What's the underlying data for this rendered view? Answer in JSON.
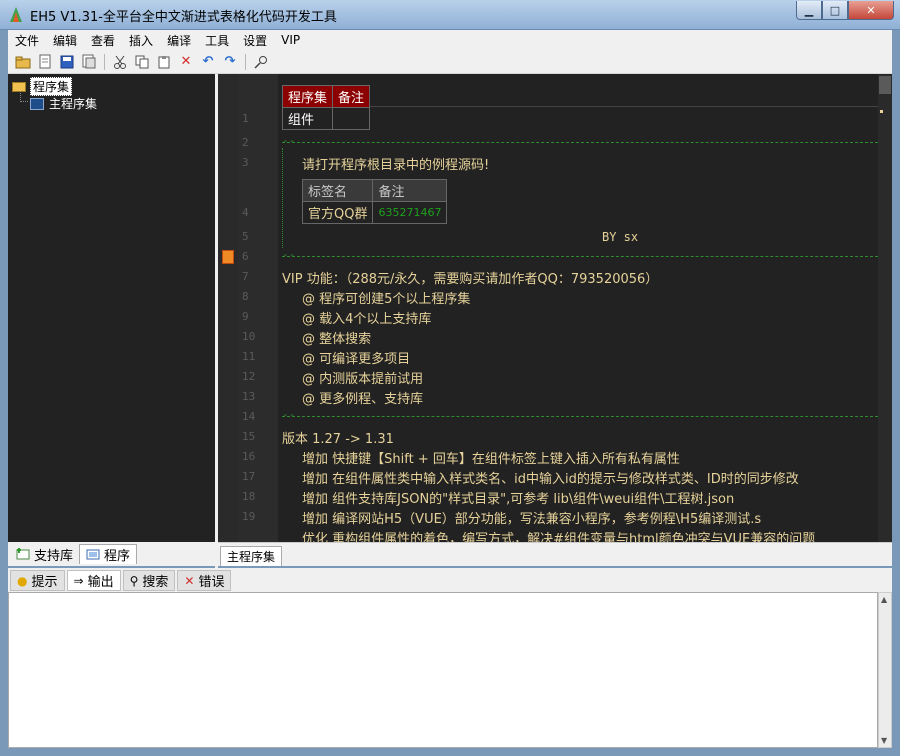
{
  "window": {
    "title": "EH5 V1.31-全平台全中文渐进式表格化代码开发工具",
    "buttons": {
      "minimize": "▁",
      "maximize": "□",
      "close": "✕"
    }
  },
  "menu": [
    "文件",
    "编辑",
    "查看",
    "插入",
    "编译",
    "工具",
    "设置",
    "VIP"
  ],
  "toolbar_icons": [
    "new-folder-icon",
    "new-file-icon",
    "save-icon",
    "save-all-icon",
    "cut-icon",
    "copy-icon",
    "paste-icon",
    "delete-icon",
    "undo-icon",
    "redo-icon",
    "search-icon"
  ],
  "tree": {
    "root": "程序集",
    "child": "主程序集"
  },
  "left_tabs": [
    "支持库",
    "程序"
  ],
  "editor": {
    "line_numbers": [
      "1",
      "2",
      "3",
      "4",
      "5",
      "6",
      "7",
      "8",
      "9",
      "10",
      "11",
      "12",
      "13",
      "14",
      "15",
      "16",
      "17",
      "18",
      "19"
    ],
    "table1": {
      "headers": [
        "程序集",
        "备注"
      ],
      "row": [
        "组件",
        ""
      ]
    },
    "dash": "--",
    "notice": "请打开程序根目录中的例程源码!",
    "table2": {
      "headers": [
        "标签名",
        "备注"
      ],
      "row": [
        "官方QQ群",
        "635271467"
      ]
    },
    "by": "BY sx",
    "vip_title": "VIP 功能：（288元/永久，需要购买请加作者QQ：793520056）",
    "vip_items": [
      "@ 程序可创建5个以上程序集",
      "@ 载入4个以上支持库",
      "@ 整体搜索",
      "@ 可编译更多项目",
      "@ 内测版本提前试用",
      "@ 更多例程、支持库"
    ],
    "version_title": "版本 1.27 -> 1.31",
    "changes": [
      "增加 快捷键【Shift + 回车】在组件标签上键入插入所有私有属性",
      "增加 在组件属性类中输入样式类名、id中输入id的提示与修改样式类、ID时的同步修改",
      "增加 组件支持库JSON的\"样式目录\",可参考 lib\\组件\\weui组件\\工程树.json",
      "增加 编译网站H5（VUE）部分功能，写法兼容小程序，参考例程\\H5编译测试.s",
      "优化 重构组件属性的着色，编写方式，解决#组件变量与html颜色冲突与VUE兼容的问题"
    ]
  },
  "editor_tab": "主程序集",
  "output_tabs": [
    "提示",
    "输出",
    "搜索",
    "错误"
  ],
  "colors": {
    "code_text": "#e6d29a",
    "green": "#1ea01e",
    "red_header": "#8b0000"
  }
}
